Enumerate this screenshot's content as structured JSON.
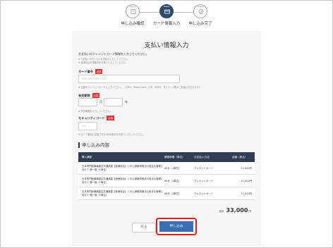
{
  "steps": [
    {
      "num": "Step1",
      "label": "申し込み確認"
    },
    {
      "num": "Step2",
      "label": "カード情報入力"
    },
    {
      "num": "Step3",
      "label": "申し込み完了"
    }
  ],
  "form": {
    "title": "支払い情報入力",
    "intro": "お支払いのクレジットカード情報を入力してください。",
    "intro_note1": "※「必須」が付いている項目は入力してください。",
    "intro_note2": "※ 各項目は半角数字を半角で入力してください。",
    "required_badge": "必須",
    "card_number": {
      "label": "カード番号",
      "placeholder": "0000 0000 0000 0000",
      "note": "※ 記載のクレジットカードに入力ください。（VISA、MasterCard、JCB、AMEX、ダイナース等がご利用いただけます）"
    },
    "expiry": {
      "label": "有効期限",
      "month_unit": "月",
      "year_unit": "年",
      "note": "※ 有効期限を入力してください。"
    },
    "security": {
      "label": "セキュリティコード",
      "placeholder": "000",
      "note": "※ カード裏面に記載された3桁の数字を半角で入力してください。"
    }
  },
  "order": {
    "title": "申し込み内容",
    "headers": [
      "購入講座",
      "講習時間（単位）",
      "お支払い方法",
      "金額（税込）"
    ],
    "rows": [
      {
        "course": "日本専門医機構認定共通講習【医療安全】と中心静脈栄養法の安全な管理に向けて 第一講（1単位）",
        "hours": "60分（1単位）",
        "method": "クレジットカード",
        "price": "11,000円"
      },
      {
        "course": "日本専門医機構認定共通講習【医療安全】と中心静脈栄養法の安全な管理に向けて 第一講（1単位）",
        "hours": "60分（1単位）",
        "method": "クレジットカード",
        "price": "11,000円"
      },
      {
        "course": "日本専門医機構認定共通講習【医療安全】と中心静脈栄養法の安全な管理に向けて 第一講（1単位）",
        "hours": "60分（1単位）",
        "method": "クレジットカード",
        "price": "11,000円"
      }
    ],
    "total_label": "合計",
    "total_value": "33,000",
    "total_unit": "円"
  },
  "buttons": {
    "back": "戻る",
    "submit": "申し込み"
  },
  "colors": {
    "active_step": "#2d4a6b",
    "table_header": "#2f3e50",
    "submit": "#3a6fb6",
    "highlight": "#e31b1b",
    "required": "#dd3333"
  }
}
